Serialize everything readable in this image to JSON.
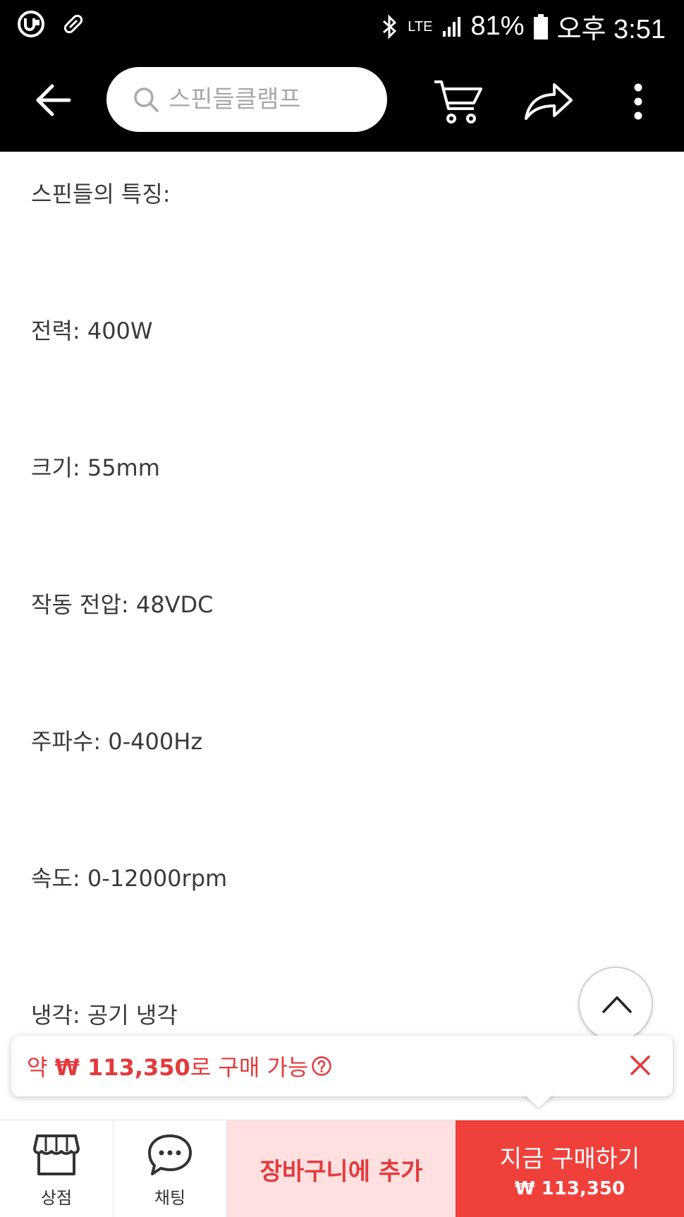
{
  "status_bar": {
    "bluetooth_icon": "bluetooth-icon",
    "network": "LTE",
    "battery": "81%",
    "time": "오후 3:51"
  },
  "toolbar": {
    "search_placeholder": "스핀들클램프",
    "icons": [
      "back-arrow-icon",
      "search-icon",
      "cart-icon",
      "share-icon",
      "more-vertical-icon"
    ]
  },
  "specs": {
    "heading": "스핀들의 특징:",
    "items": [
      "전력: 400W",
      "크기: 55mm",
      "작동 전압: 48VDC",
      "주파수: 0-400Hz",
      "속도: 0-12000rpm",
      "냉각: 공기 냉각"
    ]
  },
  "price_tip": {
    "prefix": "약 ",
    "amount": "₩ 113,350",
    "suffix": "로 구매 가능",
    "accent_color": "#e4393c"
  },
  "bottom_bar": {
    "store_label": "상점",
    "chat_label": "채팅",
    "add_to_cart_label": "장바구니에 추가",
    "buy_now_label": "지금 구매하기",
    "buy_now_price": "₩ 113,350",
    "buy_color": "#f0403b",
    "cart_color": "#fde0df"
  }
}
